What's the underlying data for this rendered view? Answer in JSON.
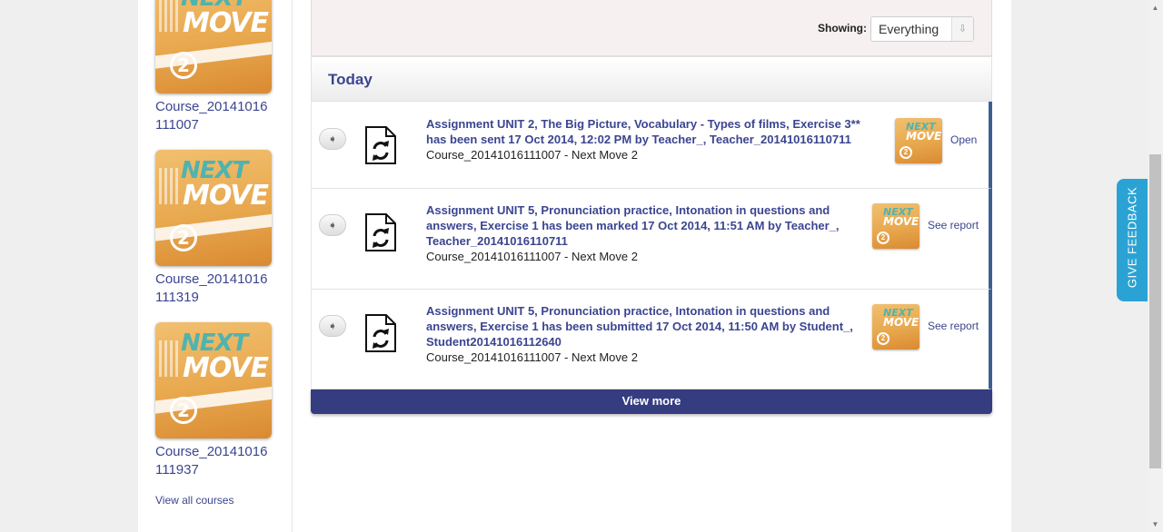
{
  "sidebar": {
    "courses": [
      {
        "name": "Course_20141016\n111007",
        "logo_text_1": "NEXT",
        "logo_text_2": "MOVE",
        "logo_num": "2"
      },
      {
        "name": "Course_20141016\n111319",
        "logo_text_1": "NEXT",
        "logo_text_2": "MOVE",
        "logo_num": "2"
      },
      {
        "name": "Course_20141016\n111937",
        "logo_text_1": "NEXT",
        "logo_text_2": "MOVE",
        "logo_num": "2"
      }
    ],
    "view_all": "View all courses"
  },
  "filter": {
    "label": "Showing:",
    "selected": "Everything",
    "arrow": "⇩"
  },
  "section_title": "Today",
  "items": [
    {
      "title": "Assignment UNIT 2, The Big Picture, Vocabulary - Types of films, Exercise 3** has been sent 17 Oct 2014, 12:02 PM by Teacher_, Teacher_20141016110711",
      "course": "Course_20141016111007 - Next Move 2",
      "action": "Open",
      "arrow": "➧"
    },
    {
      "title": "Assignment UNIT 5, Pronunciation practice, Intonation in questions and answers, Exercise 1 has been marked 17 Oct 2014, 11:51 AM by Teacher_, Teacher_20141016110711",
      "course": "Course_20141016111007 - Next Move 2",
      "action": "See report",
      "arrow": "➧"
    },
    {
      "title": "Assignment UNIT 5, Pronunciation practice, Intonation in questions and answers, Exercise 1 has been submitted 17 Oct 2014, 11:50 AM by Student_, Student20141016112640",
      "course": "Course_20141016111007 - Next Move 2",
      "action": "See report",
      "arrow": "➧"
    }
  ],
  "mini_logo": {
    "text_1": "NEXT",
    "text_2": "MOVE",
    "num": "2"
  },
  "view_more": "View more",
  "feedback": "GIVE FEEDBACK",
  "scroll": {
    "up": "▲",
    "down": "▼"
  },
  "colors": {
    "accent": "#353c80",
    "link": "#3b4590",
    "feedback": "#2aa3d4",
    "item_border": "#3f5e92"
  }
}
